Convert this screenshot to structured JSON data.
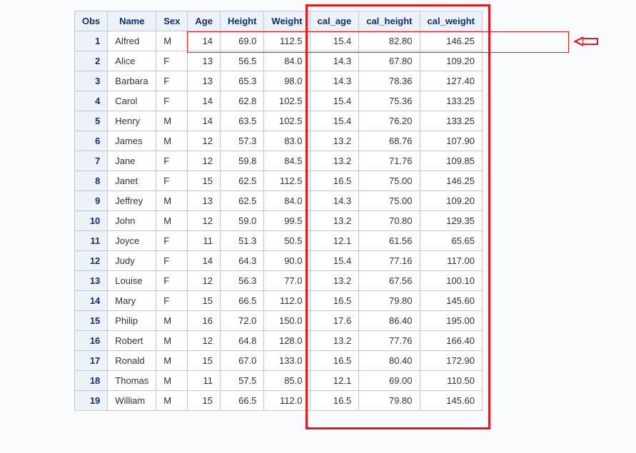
{
  "table": {
    "headers": [
      "Obs",
      "Name",
      "Sex",
      "Age",
      "Height",
      "Weight",
      "cal_age",
      "cal_height",
      "cal_weight"
    ],
    "rows": [
      {
        "obs": "1",
        "name": "Alfred",
        "sex": "M",
        "age": "14",
        "height": "69.0",
        "weight": "112.5",
        "cal_age": "15.4",
        "cal_height": "82.80",
        "cal_weight": "146.25"
      },
      {
        "obs": "2",
        "name": "Alice",
        "sex": "F",
        "age": "13",
        "height": "56.5",
        "weight": "84.0",
        "cal_age": "14.3",
        "cal_height": "67.80",
        "cal_weight": "109.20"
      },
      {
        "obs": "3",
        "name": "Barbara",
        "sex": "F",
        "age": "13",
        "height": "65.3",
        "weight": "98.0",
        "cal_age": "14.3",
        "cal_height": "78.36",
        "cal_weight": "127.40"
      },
      {
        "obs": "4",
        "name": "Carol",
        "sex": "F",
        "age": "14",
        "height": "62.8",
        "weight": "102.5",
        "cal_age": "15.4",
        "cal_height": "75.36",
        "cal_weight": "133.25"
      },
      {
        "obs": "5",
        "name": "Henry",
        "sex": "M",
        "age": "14",
        "height": "63.5",
        "weight": "102.5",
        "cal_age": "15.4",
        "cal_height": "76.20",
        "cal_weight": "133.25"
      },
      {
        "obs": "6",
        "name": "James",
        "sex": "M",
        "age": "12",
        "height": "57.3",
        "weight": "83.0",
        "cal_age": "13.2",
        "cal_height": "68.76",
        "cal_weight": "107.90"
      },
      {
        "obs": "7",
        "name": "Jane",
        "sex": "F",
        "age": "12",
        "height": "59.8",
        "weight": "84.5",
        "cal_age": "13.2",
        "cal_height": "71.76",
        "cal_weight": "109.85"
      },
      {
        "obs": "8",
        "name": "Janet",
        "sex": "F",
        "age": "15",
        "height": "62.5",
        "weight": "112.5",
        "cal_age": "16.5",
        "cal_height": "75.00",
        "cal_weight": "146.25"
      },
      {
        "obs": "9",
        "name": "Jeffrey",
        "sex": "M",
        "age": "13",
        "height": "62.5",
        "weight": "84.0",
        "cal_age": "14.3",
        "cal_height": "75.00",
        "cal_weight": "109.20"
      },
      {
        "obs": "10",
        "name": "John",
        "sex": "M",
        "age": "12",
        "height": "59.0",
        "weight": "99.5",
        "cal_age": "13.2",
        "cal_height": "70.80",
        "cal_weight": "129.35"
      },
      {
        "obs": "11",
        "name": "Joyce",
        "sex": "F",
        "age": "11",
        "height": "51.3",
        "weight": "50.5",
        "cal_age": "12.1",
        "cal_height": "61.56",
        "cal_weight": "65.65"
      },
      {
        "obs": "12",
        "name": "Judy",
        "sex": "F",
        "age": "14",
        "height": "64.3",
        "weight": "90.0",
        "cal_age": "15.4",
        "cal_height": "77.16",
        "cal_weight": "117.00"
      },
      {
        "obs": "13",
        "name": "Louise",
        "sex": "F",
        "age": "12",
        "height": "56.3",
        "weight": "77.0",
        "cal_age": "13.2",
        "cal_height": "67.56",
        "cal_weight": "100.10"
      },
      {
        "obs": "14",
        "name": "Mary",
        "sex": "F",
        "age": "15",
        "height": "66.5",
        "weight": "112.0",
        "cal_age": "16.5",
        "cal_height": "79.80",
        "cal_weight": "145.60"
      },
      {
        "obs": "15",
        "name": "Philip",
        "sex": "M",
        "age": "16",
        "height": "72.0",
        "weight": "150.0",
        "cal_age": "17.6",
        "cal_height": "86.40",
        "cal_weight": "195.00"
      },
      {
        "obs": "16",
        "name": "Robert",
        "sex": "M",
        "age": "12",
        "height": "64.8",
        "weight": "128.0",
        "cal_age": "13.2",
        "cal_height": "77.76",
        "cal_weight": "166.40"
      },
      {
        "obs": "17",
        "name": "Ronald",
        "sex": "M",
        "age": "15",
        "height": "67.0",
        "weight": "133.0",
        "cal_age": "16.5",
        "cal_height": "80.40",
        "cal_weight": "172.90"
      },
      {
        "obs": "18",
        "name": "Thomas",
        "sex": "M",
        "age": "11",
        "height": "57.5",
        "weight": "85.0",
        "cal_age": "12.1",
        "cal_height": "69.00",
        "cal_weight": "110.50"
      },
      {
        "obs": "19",
        "name": "William",
        "sex": "M",
        "age": "15",
        "height": "66.5",
        "weight": "112.0",
        "cal_age": "16.5",
        "cal_height": "79.80",
        "cal_weight": "145.60"
      }
    ]
  },
  "annotations": {
    "highlight_columns": [
      "cal_age",
      "cal_height",
      "cal_weight"
    ],
    "row_highlight_obs": "1",
    "arrow_points_to": "row-1"
  }
}
